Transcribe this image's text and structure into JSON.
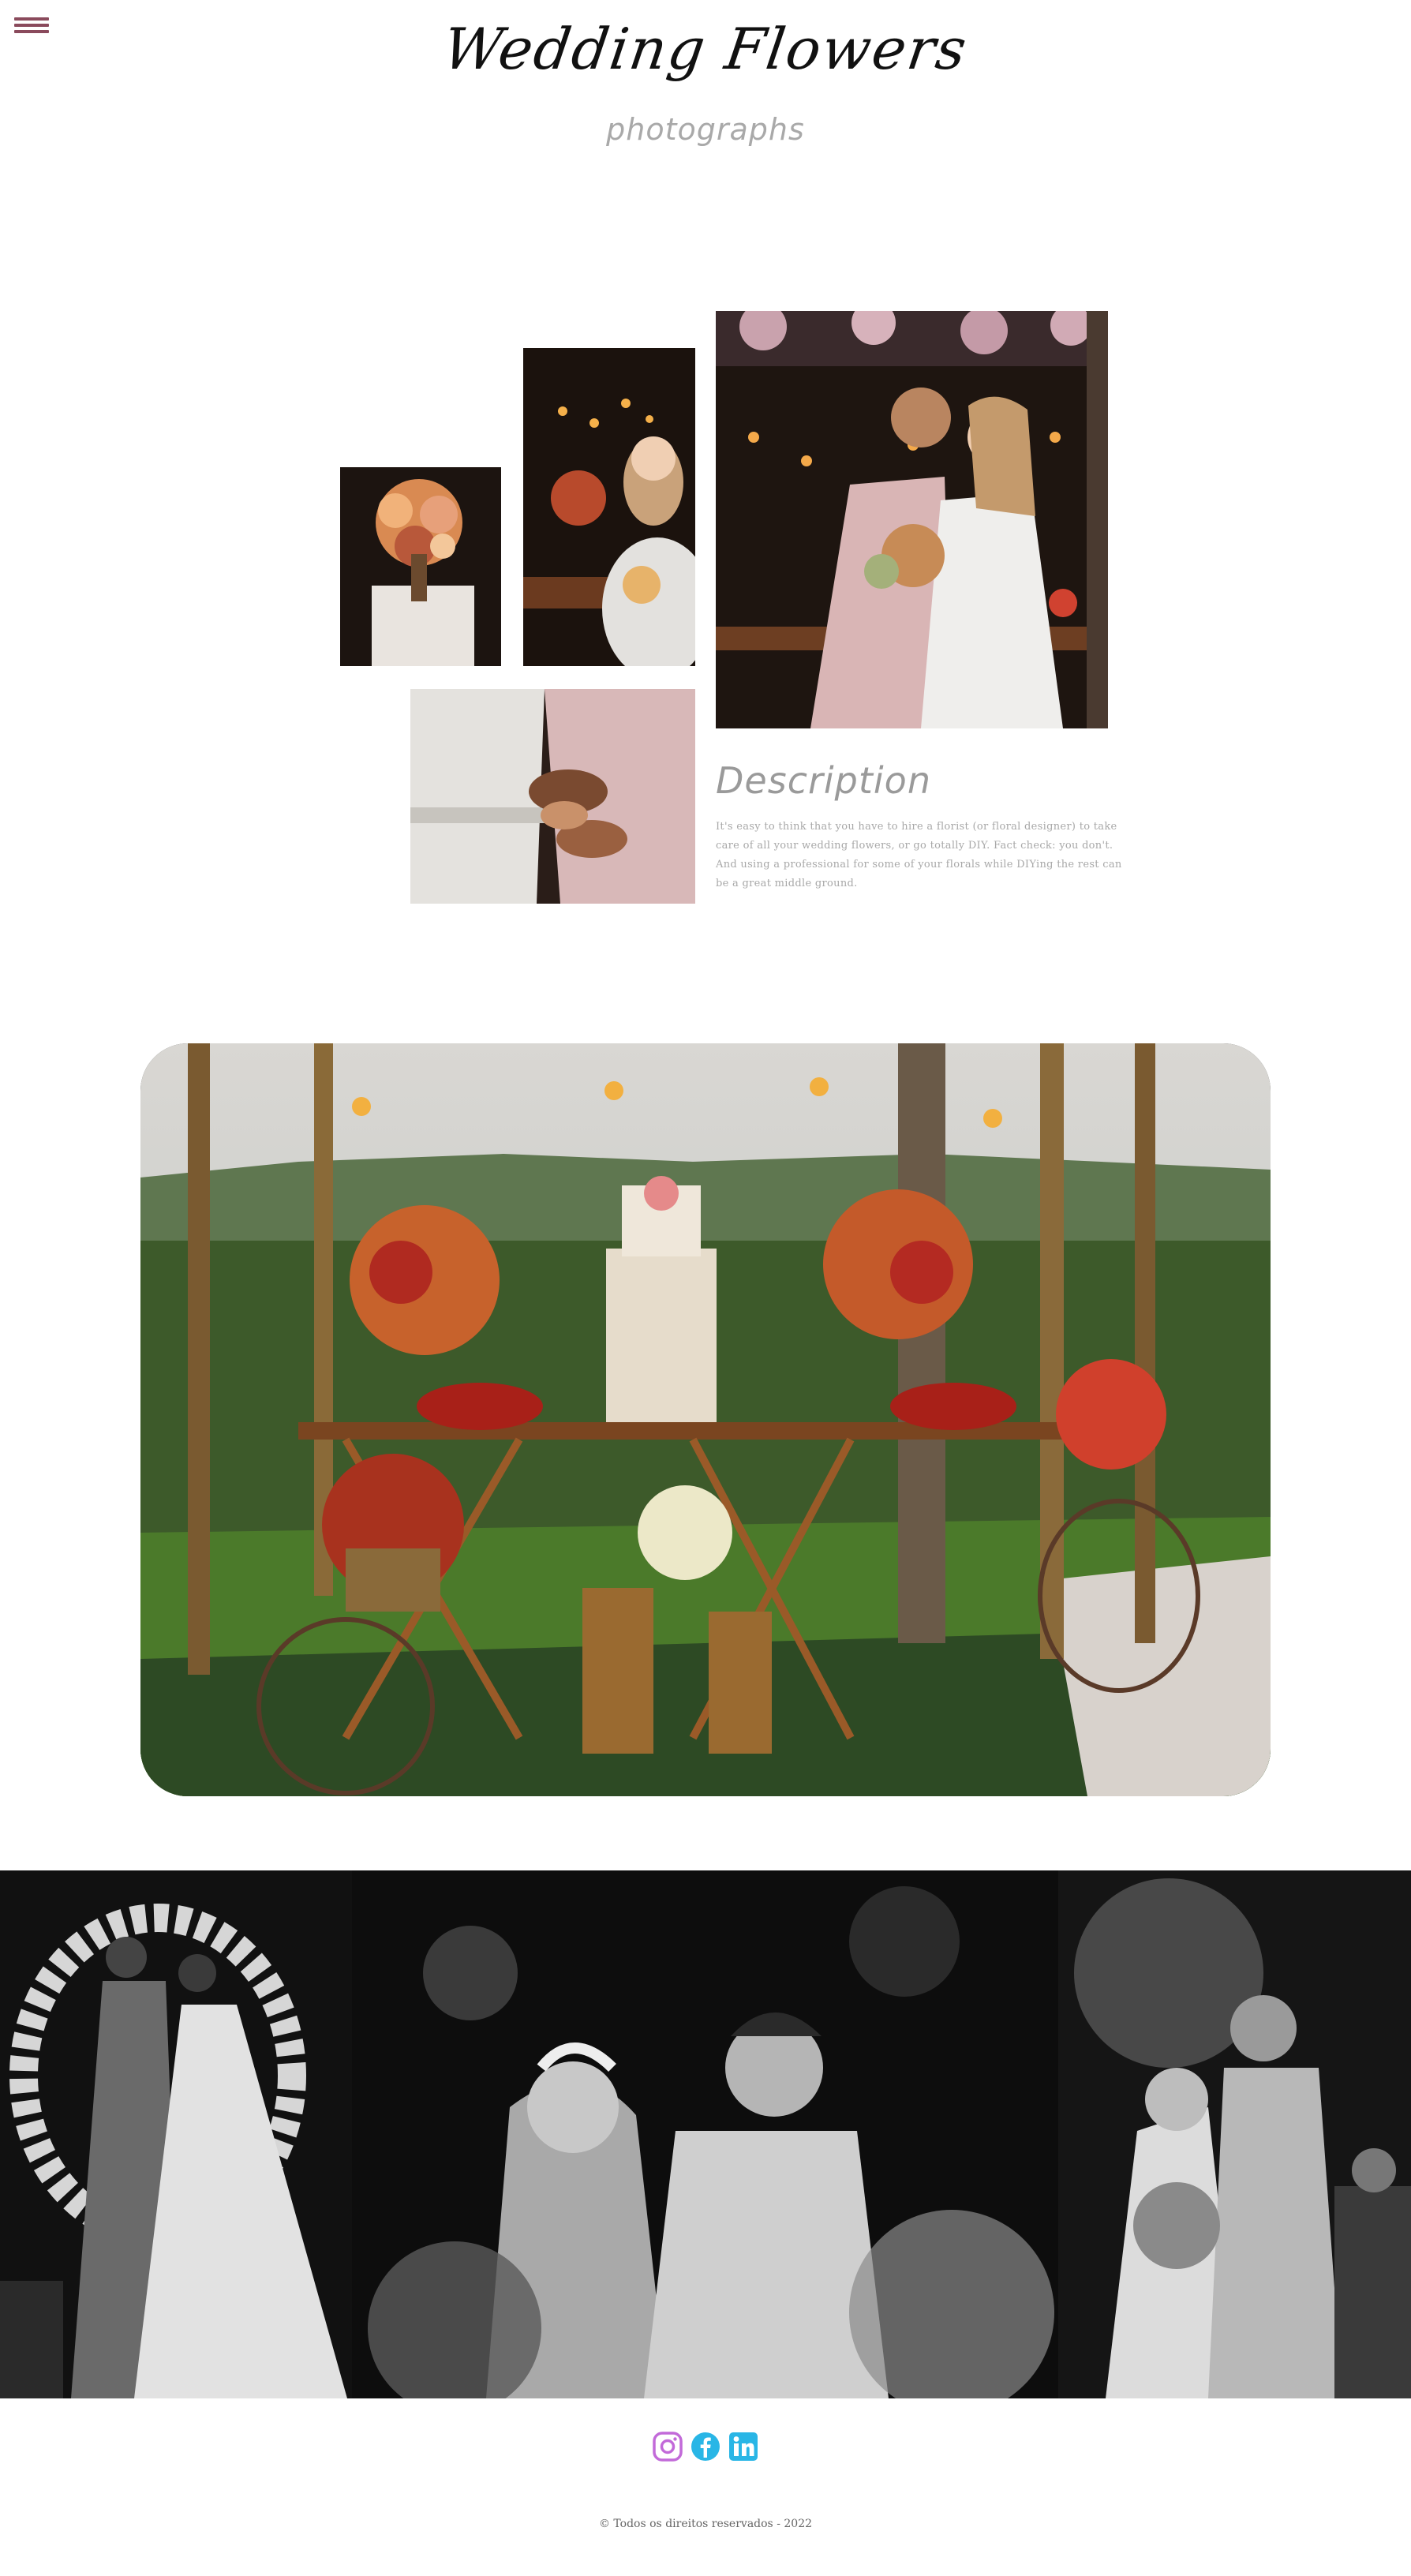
{
  "header": {
    "menu_icon": "hamburger-menu-icon",
    "title": "Wedding Flowers",
    "subtitle": "photographs"
  },
  "gallery": {
    "images": [
      {
        "name": "bouquet-closeup-photo"
      },
      {
        "name": "bride-with-bouquet-photo"
      },
      {
        "name": "couple-embrace-photo"
      },
      {
        "name": "holding-hands-photo"
      }
    ]
  },
  "description": {
    "title": "Description",
    "text": "It's easy to think that you have to hire a florist (or floral designer) to take care of all your wedding flowers, or go totally DIY. Fact check: you don't. And using a professional for some of your florals while DIYing the rest can be a great middle ground."
  },
  "hero": {
    "name": "cake-table-photo"
  },
  "strip": [
    {
      "name": "ceremony-arch-photo"
    },
    {
      "name": "couple-smiling-photo"
    },
    {
      "name": "first-dance-photo"
    }
  ],
  "footer": {
    "social": [
      {
        "icon": "instagram-icon",
        "color": "#c26ad9"
      },
      {
        "icon": "facebook-icon",
        "color": "#29b6e6"
      },
      {
        "icon": "linkedin-icon",
        "color": "#29b6e6"
      }
    ],
    "copyright": "© Todos os direitos reservados - 2022"
  },
  "colors": {
    "menu": "#8a4a5c",
    "background": "#ffffff",
    "muted_text": "#a8a8a8"
  }
}
